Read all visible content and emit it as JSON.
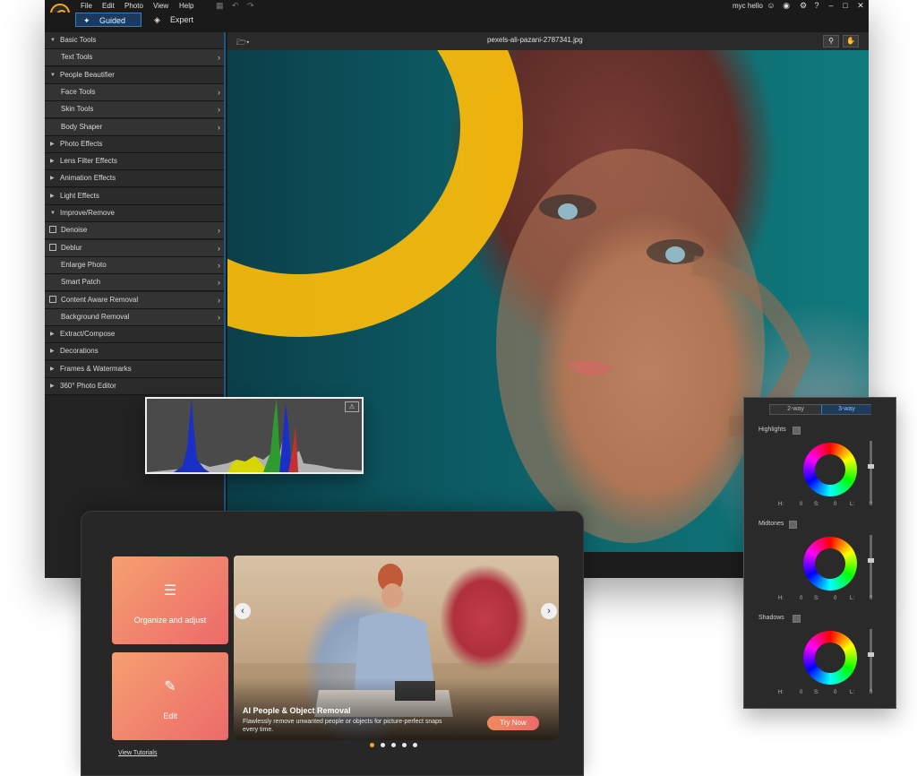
{
  "menubar": {
    "items": [
      "File",
      "Edit",
      "Photo",
      "View",
      "Help"
    ],
    "user": "myc hello",
    "icons": [
      "save-icon",
      "undo-icon",
      "redo-icon",
      "user-icon",
      "badge-icon",
      "settings-icon",
      "help-icon",
      "minimize-icon",
      "maximize-icon",
      "close-icon"
    ],
    "help_glyph": "?"
  },
  "modes": {
    "guided": "Guided",
    "expert": "Expert",
    "active": "guided"
  },
  "sidebar": {
    "items": [
      {
        "label": "Basic Tools",
        "kind": "category",
        "expanded": true
      },
      {
        "label": "Text Tools",
        "kind": "sub"
      },
      {
        "label": "People Beautifier",
        "kind": "category",
        "expanded": true
      },
      {
        "label": "Face Tools",
        "kind": "sub"
      },
      {
        "label": "Skin Tools",
        "kind": "sub"
      },
      {
        "label": "Body Shaper",
        "kind": "sub"
      },
      {
        "label": "Photo Effects",
        "kind": "category",
        "expanded": false
      },
      {
        "label": "Lens Filter Effects",
        "kind": "category",
        "expanded": false
      },
      {
        "label": "Animation Effects",
        "kind": "category",
        "expanded": false
      },
      {
        "label": "Light Effects",
        "kind": "category",
        "expanded": false
      },
      {
        "label": "Improve/Remove",
        "kind": "category",
        "expanded": true
      },
      {
        "label": "Denoise",
        "kind": "sub-ai"
      },
      {
        "label": "Deblur",
        "kind": "sub-ai"
      },
      {
        "label": "Enlarge Photo",
        "kind": "sub"
      },
      {
        "label": "Smart Patch",
        "kind": "sub"
      },
      {
        "label": "Content Aware Removal",
        "kind": "sub-ai"
      },
      {
        "label": "Background Removal",
        "kind": "sub"
      },
      {
        "label": "Extract/Compose",
        "kind": "category",
        "expanded": false
      },
      {
        "label": "Decorations",
        "kind": "category",
        "expanded": false
      },
      {
        "label": "Frames & Watermarks",
        "kind": "category",
        "expanded": false
      },
      {
        "label": "360° Photo Editor",
        "kind": "category",
        "expanded": false
      }
    ]
  },
  "canvas": {
    "filename": "pexels-ali-pazani-2787341.jpg",
    "tools": [
      "zoom-icon",
      "hand-icon"
    ]
  },
  "color_wheels": {
    "tabs": [
      "2-way",
      "3-way"
    ],
    "active_tab": "3-way",
    "sections": [
      {
        "label": "Highlights",
        "h": "0",
        "s": "0",
        "l": "0"
      },
      {
        "label": "Midtones",
        "h": "0",
        "s": "0",
        "l": "0"
      },
      {
        "label": "Shadows",
        "h": "0",
        "s": "0",
        "l": "0"
      }
    ],
    "h_label": "H:",
    "s_label": "S:",
    "l_label": "L:"
  },
  "welcome": {
    "tiles": [
      {
        "label": "Organize and adjust",
        "icon": "sliders-icon"
      },
      {
        "label": "Edit",
        "icon": "photo-edit-icon"
      }
    ],
    "banner": {
      "title": "AI People & Object Removal",
      "desc": "Flawlessly remove unwanted people or objects for picture-perfect snaps every time.",
      "cta": "Try Now"
    },
    "dots": 5,
    "active_dot": 0,
    "view_tutorials": "View Tutorials",
    "colors": {
      "accent": "#f5a623",
      "dot_inactive": "#e8e8e8"
    }
  },
  "colors": {
    "accent_blue": "#3f7ab8",
    "ring_yellow": "#f5b90c",
    "panel_bg": "#222222"
  }
}
